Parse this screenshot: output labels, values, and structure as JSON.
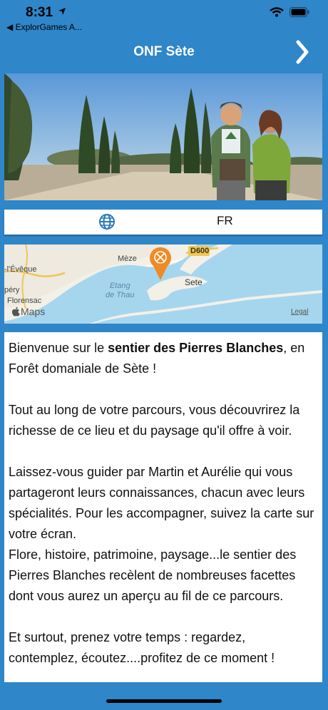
{
  "status": {
    "time": "8:31",
    "back_app": "◀ ExplorGames A..."
  },
  "nav": {
    "title": "ONF Sète"
  },
  "language": {
    "code": "FR"
  },
  "map": {
    "labels": {
      "meze": "Mèze",
      "road": "D600",
      "leveque": "-l'Évêque",
      "pery": "péry",
      "etang": "Etang\nde Thau",
      "sete": "Sete",
      "florensac": "Florensac",
      "maps": "Maps",
      "legal": "Legal"
    }
  },
  "content": {
    "p1_start": "Bienvenue sur le ",
    "p1_bold": "sentier des Pierres Blanches",
    "p1_end": ", en Forêt domaniale de Sète !",
    "p2": "Tout au long de votre parcours, vous découvrirez la richesse de ce lieu et du paysage qu'il offre à voir.",
    "p3": "Laissez-vous guider par Martin et Aurélie qui vous partageront leurs connaissances, chacun avec leurs spécialités. Pour les accompagner, suivez la carte sur votre écran.",
    "p4": "Flore, histoire, patrimoine, paysage...le sentier des Pierres Blanches recèlent de nombreuses facettes dont vous aurez un aperçu au fil de ce parcours.",
    "p5": "Et surtout, prenez votre temps : regardez, contemplez, écoutez....profitez de ce moment !"
  }
}
